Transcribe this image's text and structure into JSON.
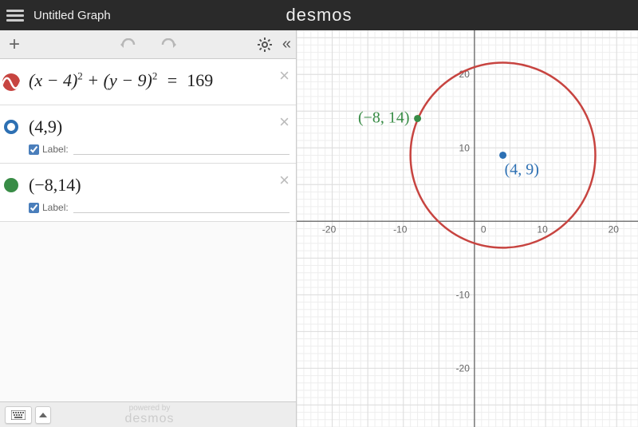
{
  "header": {
    "title": "Untitled Graph",
    "brand": "desmos"
  },
  "toolbar": {
    "add_tooltip": "+"
  },
  "expressions": [
    {
      "indicator": "wave",
      "color": "#c74440",
      "latex_display_html": "(<i>x</i> − 4)<span class='sup'>2</span> + (<i>y</i> − 9)<span class='sup'>2</span>&nbsp; =&nbsp; <span class='rm'>169</span>",
      "has_label": false
    },
    {
      "indicator": "open-point",
      "color": "#2d70b3",
      "latex_display_html": "(4,9)",
      "has_label": true,
      "label_text": "Label:"
    },
    {
      "indicator": "filled-point",
      "color": "#388c46",
      "latex_display_html": "(−8,14)",
      "has_label": true,
      "label_text": "Label:"
    }
  ],
  "footer": {
    "powered_small": "powered by",
    "powered_big": "desmos"
  },
  "graph": {
    "x_range": [
      -25,
      23
    ],
    "y_range": [
      -28,
      26
    ],
    "ticks_x": [
      -20,
      -10,
      0,
      10,
      20
    ],
    "ticks_y": [
      -20,
      -10,
      10,
      20
    ],
    "circle": {
      "cx": 4,
      "cy": 9,
      "r": 13,
      "color": "#c74440"
    },
    "points": [
      {
        "x": 4,
        "y": 9,
        "color": "#2d70b3",
        "label": "(4, 9)",
        "label_pos": "below-right"
      },
      {
        "x": -8,
        "y": 14,
        "color": "#388c46",
        "label": "(−8, 14)",
        "label_pos": "left"
      }
    ]
  }
}
